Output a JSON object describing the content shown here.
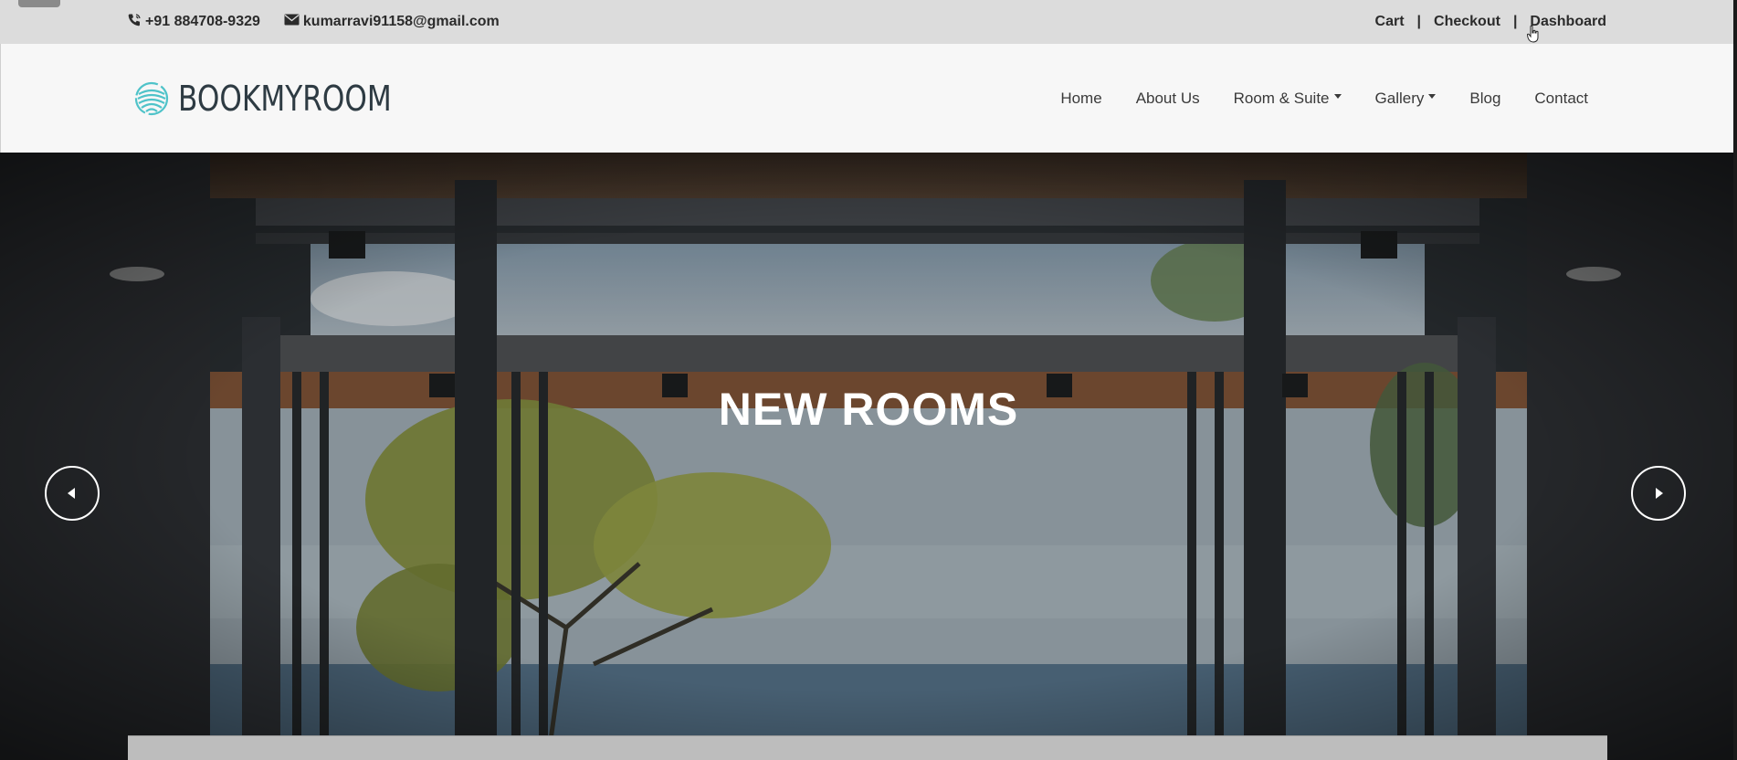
{
  "topbar": {
    "phone": "+91 884708-9329",
    "email": "kumarravi91158@gmail.com",
    "links": [
      "Cart",
      "Checkout",
      "Dashboard"
    ],
    "separator": "|"
  },
  "header": {
    "logo_text": "BOOKMYROOM",
    "nav": [
      {
        "label": "Home",
        "dropdown": false
      },
      {
        "label": "About Us",
        "dropdown": false
      },
      {
        "label": "Room & Suite",
        "dropdown": true
      },
      {
        "label": "Gallery",
        "dropdown": true
      },
      {
        "label": "Blog",
        "dropdown": false
      },
      {
        "label": "Contact",
        "dropdown": false
      }
    ]
  },
  "hero": {
    "title": "NEW ROOMS"
  },
  "colors": {
    "logo_accent": "#4fc3c9",
    "topbar_bg": "#dcdcdc",
    "header_bg": "#f7f7f7"
  }
}
